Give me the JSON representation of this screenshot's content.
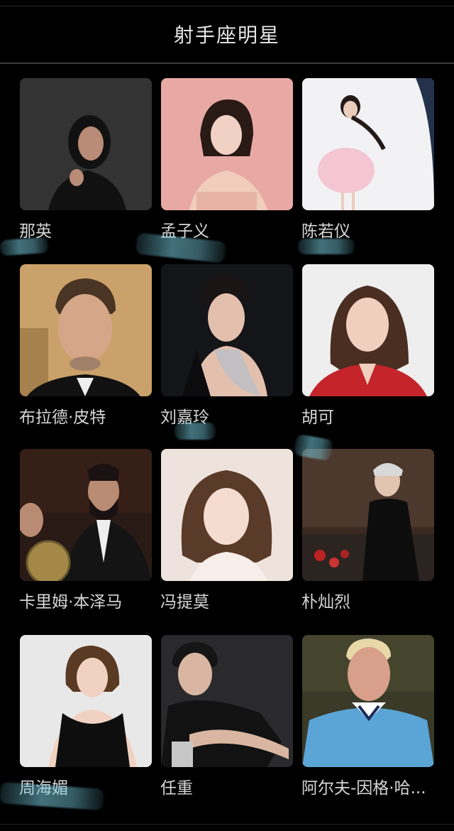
{
  "header": {
    "title": "射手座明星"
  },
  "celebrities": [
    {
      "name": "那英"
    },
    {
      "name": "孟子义"
    },
    {
      "name": "陈若仪"
    },
    {
      "name": "布拉德·皮特"
    },
    {
      "name": "刘嘉玲"
    },
    {
      "name": "胡可"
    },
    {
      "name": "卡里姆·本泽马"
    },
    {
      "name": "冯提莫"
    },
    {
      "name": "朴灿烈"
    },
    {
      "name": "周海媚"
    },
    {
      "name": "任重"
    },
    {
      "name": "阿尔夫-因格·哈..."
    }
  ],
  "colors": {
    "background": "#000000",
    "text": "#d6d6d6",
    "divider": "#3a3a3a"
  }
}
